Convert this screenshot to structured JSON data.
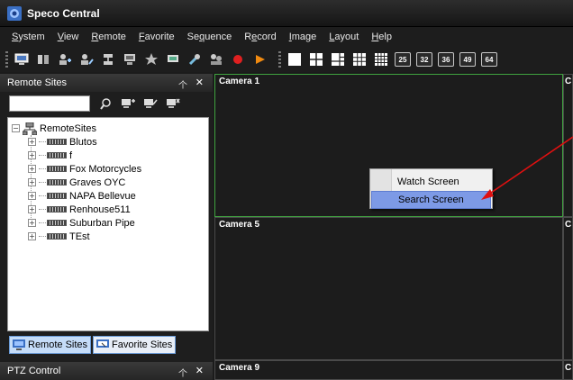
{
  "window": {
    "title": "Speco Central"
  },
  "menu": {
    "items": [
      {
        "pre": "",
        "ul": "S",
        "post": "ystem"
      },
      {
        "pre": "",
        "ul": "V",
        "post": "iew"
      },
      {
        "pre": "",
        "ul": "R",
        "post": "emote"
      },
      {
        "pre": "",
        "ul": "F",
        "post": "avorite"
      },
      {
        "pre": "Se",
        "ul": "q",
        "post": "uence"
      },
      {
        "pre": "R",
        "ul": "e",
        "post": "cord"
      },
      {
        "pre": "",
        "ul": "I",
        "post": "mage"
      },
      {
        "pre": "",
        "ul": "L",
        "post": "ayout"
      },
      {
        "pre": "",
        "ul": "H",
        "post": "elp"
      }
    ]
  },
  "toolbar": {
    "layout_numbers": [
      "25",
      "32",
      "36",
      "49",
      "64"
    ]
  },
  "remote_sites": {
    "title": "Remote Sites",
    "search_value": "",
    "root": "RemoteSites",
    "sites": [
      "Blutos",
      "f",
      "Fox Motorcycles",
      "Graves OYC",
      "NAPA Bellevue",
      "Renhouse511",
      "Suburban Pipe",
      "TEst"
    ],
    "tabs": [
      "Remote Sites",
      "Favorite Sites"
    ]
  },
  "ptz": {
    "title": "PTZ Control"
  },
  "cameras": {
    "c1": "Camera 1",
    "c5": "Camera 5",
    "c9": "Camera 9",
    "r1": "C",
    "r2": "C",
    "r3": "C"
  },
  "context_menu": {
    "items": [
      "Watch Screen",
      "Search Screen"
    ]
  },
  "colors": {
    "selected_border": "#3fa33f",
    "highlight": "#7d9ae6",
    "annotation_arrow": "#e01010"
  }
}
